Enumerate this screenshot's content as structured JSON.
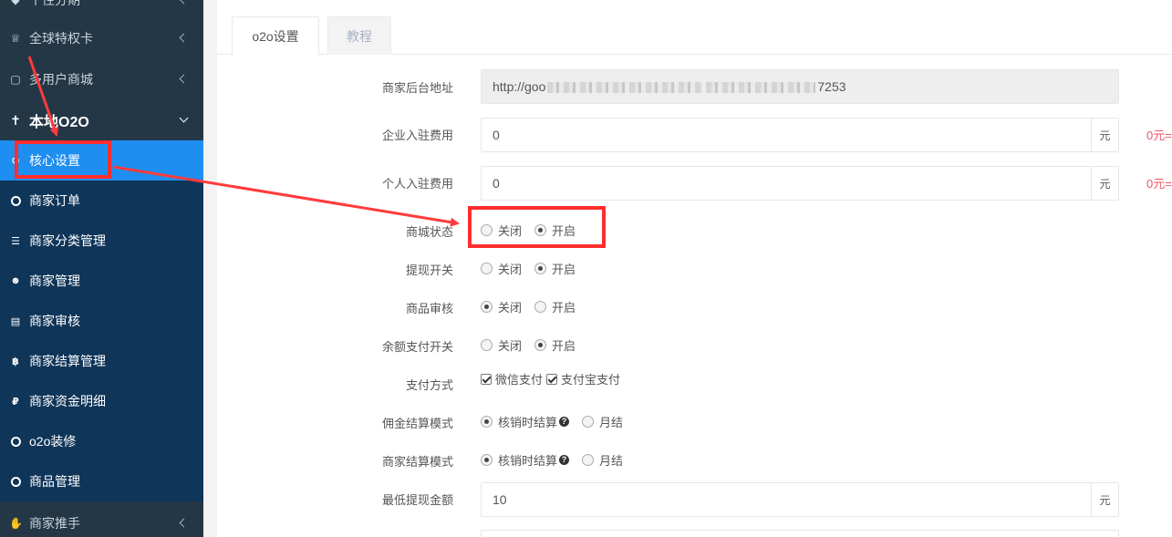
{
  "sidebar": {
    "items": [
      {
        "label": "个性分期",
        "icon": "tag-icon"
      },
      {
        "label": "全球特权卡",
        "icon": "crown-icon"
      },
      {
        "label": "多用户商城",
        "icon": "shop-icon"
      },
      {
        "label": "本地O2O",
        "icon": "pin-icon"
      }
    ],
    "submenu": [
      {
        "label": "核心设置",
        "icon": "gear-icon"
      },
      {
        "label": "商家订单",
        "icon": "circle-icon"
      },
      {
        "label": "商家分类管理",
        "icon": "list-icon"
      },
      {
        "label": "商家管理",
        "icon": "users-icon"
      },
      {
        "label": "商家审核",
        "icon": "id-card-icon"
      },
      {
        "label": "商家结算管理",
        "icon": "bitcoin-icon"
      },
      {
        "label": "商家资金明细",
        "icon": "ruble-icon"
      },
      {
        "label": "o2o装修",
        "icon": "circle-icon"
      },
      {
        "label": "商品管理",
        "icon": "circle-icon"
      }
    ],
    "bottom": {
      "label": "商家推手",
      "icon": "hand-icon"
    }
  },
  "tabs": [
    {
      "label": "o2o设置"
    },
    {
      "label": "教程"
    }
  ],
  "form": {
    "backend_url": {
      "label": "商家后台地址",
      "value_start": "http://goo",
      "value_end": "7253"
    },
    "company_fee": {
      "label": "企业入驻费用",
      "value": "0",
      "unit": "元",
      "hint": "0元="
    },
    "personal_fee": {
      "label": "个人入驻费用",
      "value": "0",
      "unit": "元",
      "hint": "0元="
    },
    "mall_status": {
      "label": "商城状态",
      "options": [
        "关闭",
        "开启"
      ]
    },
    "withdraw_switch": {
      "label": "提现开关",
      "options": [
        "关闭",
        "开启"
      ]
    },
    "product_review": {
      "label": "商品审核",
      "options": [
        "关闭",
        "开启"
      ]
    },
    "balance_pay": {
      "label": "余额支付开关",
      "options": [
        "关闭",
        "开启"
      ]
    },
    "pay_method": {
      "label": "支付方式",
      "options": [
        "微信支付",
        "支付宝支付"
      ]
    },
    "commission_mode": {
      "label": "佣金结算模式",
      "options": [
        "核销时结算",
        "月结"
      ]
    },
    "merchant_mode": {
      "label": "商家结算模式",
      "options": [
        "核销时结算",
        "月结"
      ]
    },
    "min_withdraw": {
      "label": "最低提现金额",
      "value": "10",
      "unit": "元"
    }
  },
  "colors": {
    "sidebar_bg": "#243747",
    "submenu_bg": "#0f3559",
    "active_bg": "#1e8ef0",
    "hint_red": "#ed5565",
    "annotation_red": "#ff2e2e"
  }
}
